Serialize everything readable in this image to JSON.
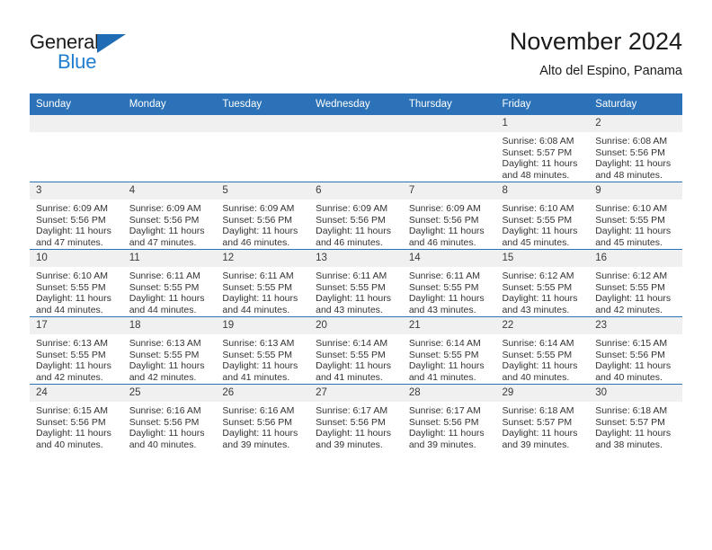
{
  "brand": {
    "name_part1": "General",
    "name_part2": "Blue",
    "triangle_color": "#1f6cb4",
    "blue_color": "#1f7ed0"
  },
  "header": {
    "title": "November 2024",
    "subtitle": "Alto del Espino, Panama",
    "accent_color": "#2c72b8"
  },
  "calendar": {
    "weekday_headers": [
      "Sunday",
      "Monday",
      "Tuesday",
      "Wednesday",
      "Thursday",
      "Friday",
      "Saturday"
    ],
    "weeks": [
      [
        {
          "day": "",
          "sunrise": "",
          "sunset": "",
          "daylight": "",
          "empty": true
        },
        {
          "day": "",
          "sunrise": "",
          "sunset": "",
          "daylight": "",
          "empty": true
        },
        {
          "day": "",
          "sunrise": "",
          "sunset": "",
          "daylight": "",
          "empty": true
        },
        {
          "day": "",
          "sunrise": "",
          "sunset": "",
          "daylight": "",
          "empty": true
        },
        {
          "day": "",
          "sunrise": "",
          "sunset": "",
          "daylight": "",
          "empty": true
        },
        {
          "day": "1",
          "sunrise": "Sunrise: 6:08 AM",
          "sunset": "Sunset: 5:57 PM",
          "daylight": "Daylight: 11 hours and 48 minutes.",
          "empty": false
        },
        {
          "day": "2",
          "sunrise": "Sunrise: 6:08 AM",
          "sunset": "Sunset: 5:56 PM",
          "daylight": "Daylight: 11 hours and 48 minutes.",
          "empty": false
        }
      ],
      [
        {
          "day": "3",
          "sunrise": "Sunrise: 6:09 AM",
          "sunset": "Sunset: 5:56 PM",
          "daylight": "Daylight: 11 hours and 47 minutes.",
          "empty": false
        },
        {
          "day": "4",
          "sunrise": "Sunrise: 6:09 AM",
          "sunset": "Sunset: 5:56 PM",
          "daylight": "Daylight: 11 hours and 47 minutes.",
          "empty": false
        },
        {
          "day": "5",
          "sunrise": "Sunrise: 6:09 AM",
          "sunset": "Sunset: 5:56 PM",
          "daylight": "Daylight: 11 hours and 46 minutes.",
          "empty": false
        },
        {
          "day": "6",
          "sunrise": "Sunrise: 6:09 AM",
          "sunset": "Sunset: 5:56 PM",
          "daylight": "Daylight: 11 hours and 46 minutes.",
          "empty": false
        },
        {
          "day": "7",
          "sunrise": "Sunrise: 6:09 AM",
          "sunset": "Sunset: 5:56 PM",
          "daylight": "Daylight: 11 hours and 46 minutes.",
          "empty": false
        },
        {
          "day": "8",
          "sunrise": "Sunrise: 6:10 AM",
          "sunset": "Sunset: 5:55 PM",
          "daylight": "Daylight: 11 hours and 45 minutes.",
          "empty": false
        },
        {
          "day": "9",
          "sunrise": "Sunrise: 6:10 AM",
          "sunset": "Sunset: 5:55 PM",
          "daylight": "Daylight: 11 hours and 45 minutes.",
          "empty": false
        }
      ],
      [
        {
          "day": "10",
          "sunrise": "Sunrise: 6:10 AM",
          "sunset": "Sunset: 5:55 PM",
          "daylight": "Daylight: 11 hours and 44 minutes.",
          "empty": false
        },
        {
          "day": "11",
          "sunrise": "Sunrise: 6:11 AM",
          "sunset": "Sunset: 5:55 PM",
          "daylight": "Daylight: 11 hours and 44 minutes.",
          "empty": false
        },
        {
          "day": "12",
          "sunrise": "Sunrise: 6:11 AM",
          "sunset": "Sunset: 5:55 PM",
          "daylight": "Daylight: 11 hours and 44 minutes.",
          "empty": false
        },
        {
          "day": "13",
          "sunrise": "Sunrise: 6:11 AM",
          "sunset": "Sunset: 5:55 PM",
          "daylight": "Daylight: 11 hours and 43 minutes.",
          "empty": false
        },
        {
          "day": "14",
          "sunrise": "Sunrise: 6:11 AM",
          "sunset": "Sunset: 5:55 PM",
          "daylight": "Daylight: 11 hours and 43 minutes.",
          "empty": false
        },
        {
          "day": "15",
          "sunrise": "Sunrise: 6:12 AM",
          "sunset": "Sunset: 5:55 PM",
          "daylight": "Daylight: 11 hours and 43 minutes.",
          "empty": false
        },
        {
          "day": "16",
          "sunrise": "Sunrise: 6:12 AM",
          "sunset": "Sunset: 5:55 PM",
          "daylight": "Daylight: 11 hours and 42 minutes.",
          "empty": false
        }
      ],
      [
        {
          "day": "17",
          "sunrise": "Sunrise: 6:13 AM",
          "sunset": "Sunset: 5:55 PM",
          "daylight": "Daylight: 11 hours and 42 minutes.",
          "empty": false
        },
        {
          "day": "18",
          "sunrise": "Sunrise: 6:13 AM",
          "sunset": "Sunset: 5:55 PM",
          "daylight": "Daylight: 11 hours and 42 minutes.",
          "empty": false
        },
        {
          "day": "19",
          "sunrise": "Sunrise: 6:13 AM",
          "sunset": "Sunset: 5:55 PM",
          "daylight": "Daylight: 11 hours and 41 minutes.",
          "empty": false
        },
        {
          "day": "20",
          "sunrise": "Sunrise: 6:14 AM",
          "sunset": "Sunset: 5:55 PM",
          "daylight": "Daylight: 11 hours and 41 minutes.",
          "empty": false
        },
        {
          "day": "21",
          "sunrise": "Sunrise: 6:14 AM",
          "sunset": "Sunset: 5:55 PM",
          "daylight": "Daylight: 11 hours and 41 minutes.",
          "empty": false
        },
        {
          "day": "22",
          "sunrise": "Sunrise: 6:14 AM",
          "sunset": "Sunset: 5:55 PM",
          "daylight": "Daylight: 11 hours and 40 minutes.",
          "empty": false
        },
        {
          "day": "23",
          "sunrise": "Sunrise: 6:15 AM",
          "sunset": "Sunset: 5:56 PM",
          "daylight": "Daylight: 11 hours and 40 minutes.",
          "empty": false
        }
      ],
      [
        {
          "day": "24",
          "sunrise": "Sunrise: 6:15 AM",
          "sunset": "Sunset: 5:56 PM",
          "daylight": "Daylight: 11 hours and 40 minutes.",
          "empty": false
        },
        {
          "day": "25",
          "sunrise": "Sunrise: 6:16 AM",
          "sunset": "Sunset: 5:56 PM",
          "daylight": "Daylight: 11 hours and 40 minutes.",
          "empty": false
        },
        {
          "day": "26",
          "sunrise": "Sunrise: 6:16 AM",
          "sunset": "Sunset: 5:56 PM",
          "daylight": "Daylight: 11 hours and 39 minutes.",
          "empty": false
        },
        {
          "day": "27",
          "sunrise": "Sunrise: 6:17 AM",
          "sunset": "Sunset: 5:56 PM",
          "daylight": "Daylight: 11 hours and 39 minutes.",
          "empty": false
        },
        {
          "day": "28",
          "sunrise": "Sunrise: 6:17 AM",
          "sunset": "Sunset: 5:56 PM",
          "daylight": "Daylight: 11 hours and 39 minutes.",
          "empty": false
        },
        {
          "day": "29",
          "sunrise": "Sunrise: 6:18 AM",
          "sunset": "Sunset: 5:57 PM",
          "daylight": "Daylight: 11 hours and 39 minutes.",
          "empty": false
        },
        {
          "day": "30",
          "sunrise": "Sunrise: 6:18 AM",
          "sunset": "Sunset: 5:57 PM",
          "daylight": "Daylight: 11 hours and 38 minutes.",
          "empty": false
        }
      ]
    ]
  }
}
